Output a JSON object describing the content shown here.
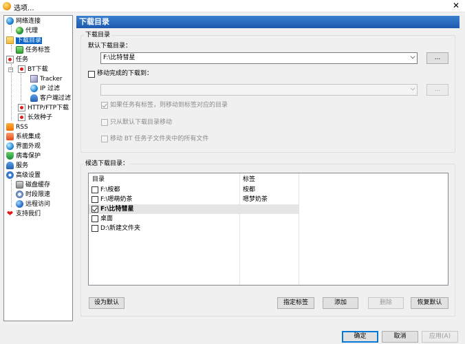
{
  "window": {
    "title": "选项..."
  },
  "tree": {
    "items": [
      {
        "label": "网络连接"
      },
      {
        "label": "代理"
      },
      {
        "label": "下载目录"
      },
      {
        "label": "任务标签"
      },
      {
        "label": "任务"
      },
      {
        "label": "BT下载"
      },
      {
        "label": "Tracker"
      },
      {
        "label": "IP 过滤"
      },
      {
        "label": "客户端过滤"
      },
      {
        "label": "HTTP/FTP下载"
      },
      {
        "label": "长效种子"
      },
      {
        "label": "RSS"
      },
      {
        "label": "系统集成"
      },
      {
        "label": "界面外观"
      },
      {
        "label": "病毒保护"
      },
      {
        "label": "服务"
      },
      {
        "label": "高级设置"
      },
      {
        "label": "磁盘缓存"
      },
      {
        "label": "时段限速"
      },
      {
        "label": "远程访问"
      },
      {
        "label": "支持我们"
      }
    ]
  },
  "panel": {
    "header": "下载目录",
    "group1_title": "下载目录",
    "default_dir_label": "默认下载目录：",
    "default_dir_value": "F:\\比特彗星",
    "browse1": "...",
    "move_completed_label": "移动完成的下载到：",
    "move_dir_value": "",
    "browse2": "...",
    "opt_move_by_tag": "如果任务有标签，则移动到标签对应的目录",
    "opt_only_default": "只从默认下载目录移动",
    "opt_move_bt_subfolder": "移动 BT 任务子文件夹中的所有文件"
  },
  "candidates": {
    "title": "候选下载目录：",
    "col_dir": "目录",
    "col_tag": "标签",
    "rows": [
      {
        "dir": "F:\\桉都",
        "tag": "桉都",
        "checked": false,
        "selected": false
      },
      {
        "dir": "F:\\嗯萌奶茶",
        "tag": "嗯梦奶茶",
        "checked": false,
        "selected": false
      },
      {
        "dir": "F:\\比特彗星",
        "tag": "",
        "checked": true,
        "selected": true
      },
      {
        "dir": "桌面",
        "tag": "",
        "checked": false,
        "selected": false
      },
      {
        "dir": "D:\\新建文件夹",
        "tag": "",
        "checked": false,
        "selected": false
      }
    ],
    "btn_set_default": "设为默认",
    "btn_assign_tag": "指定标签",
    "btn_add": "添加",
    "btn_delete": "删除",
    "btn_restore": "恢复默认"
  },
  "footer": {
    "ok": "确定",
    "cancel": "取消",
    "apply": "应用(A)"
  }
}
